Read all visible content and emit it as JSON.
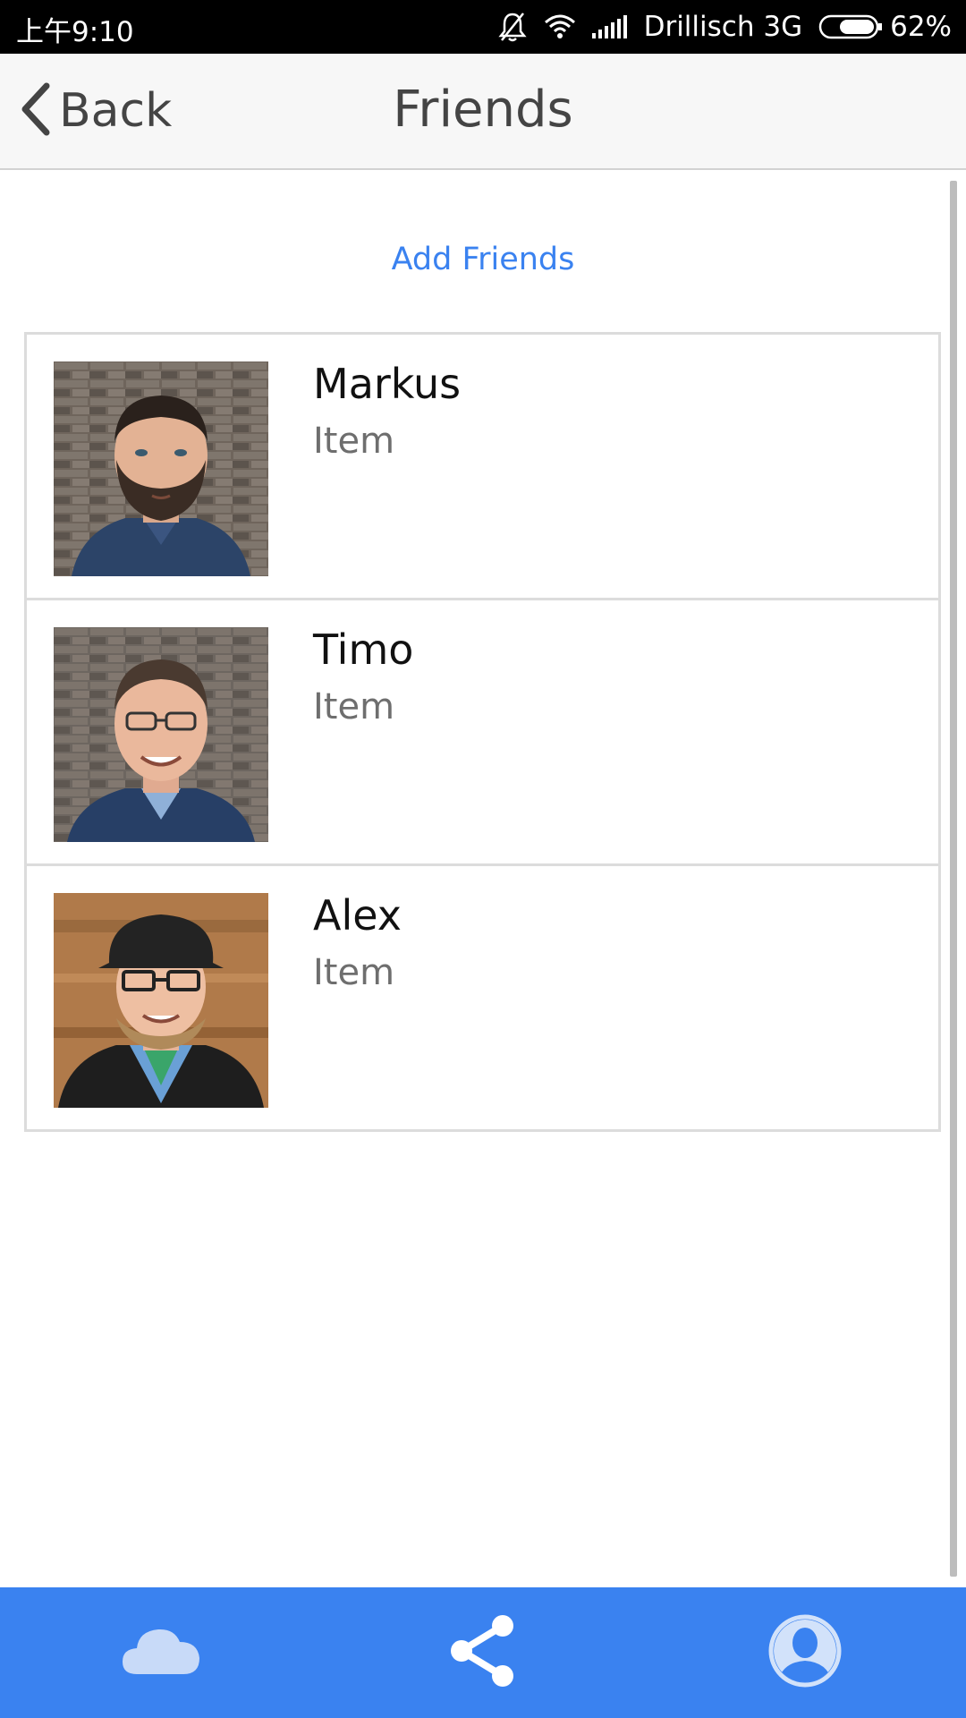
{
  "status_bar": {
    "time": "上午9:10",
    "carrier": "Drillisch 3G",
    "battery": "62%",
    "icons": [
      "bell-muted-icon",
      "wifi-icon",
      "signal-icon",
      "battery-icon"
    ]
  },
  "header": {
    "back_label": "Back",
    "title": "Friends"
  },
  "main": {
    "add_friends_label": "Add Friends",
    "friends": [
      {
        "name": "Markus",
        "subtitle": "Item"
      },
      {
        "name": "Timo",
        "subtitle": "Item"
      },
      {
        "name": "Alex",
        "subtitle": "Item"
      }
    ]
  },
  "tab_bar": {
    "tabs": [
      "cloud-icon",
      "share-icon",
      "profile-icon"
    ]
  },
  "colors": {
    "accent": "#3a82f0",
    "status_bar": "#000000",
    "header_bg": "#f7f7f7",
    "divider": "#dcdcdc"
  }
}
